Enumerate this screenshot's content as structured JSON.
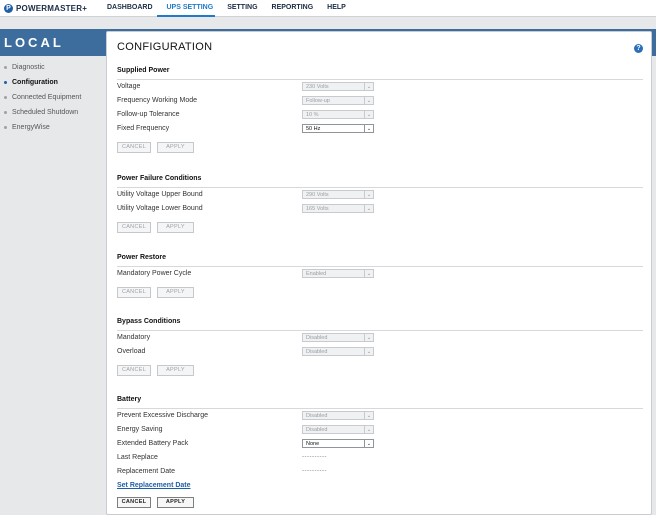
{
  "brand": {
    "name": "POWERMASTER+",
    "mark": "P"
  },
  "nav": {
    "items": [
      {
        "label": "DASHBOARD"
      },
      {
        "label": "UPS SETTING"
      },
      {
        "label": "SETTING"
      },
      {
        "label": "REPORTING"
      },
      {
        "label": "HELP"
      }
    ],
    "active": "UPS SETTING"
  },
  "sidebar": {
    "header": "LOCAL",
    "items": [
      {
        "label": "Diagnostic"
      },
      {
        "label": "Configuration"
      },
      {
        "label": "Connected Equipment"
      },
      {
        "label": "Scheduled Shutdown"
      },
      {
        "label": "EnergyWise"
      }
    ],
    "active": "Configuration"
  },
  "page": {
    "title": "CONFIGURATION",
    "help": "?"
  },
  "buttons": {
    "cancel": "CANCEL",
    "apply": "APPLY"
  },
  "sections": {
    "supplied_power": {
      "title": "Supplied Power",
      "rows": [
        {
          "label": "Voltage",
          "value": "230 Volts"
        },
        {
          "label": "Frequency Working Mode",
          "value": "Follow-up"
        },
        {
          "label": "Follow-up Tolerance",
          "value": "10 %"
        },
        {
          "label": "Fixed Frequency",
          "value": "50 Hz"
        }
      ]
    },
    "power_failure": {
      "title": "Power Failure Conditions",
      "rows": [
        {
          "label": "Utility Voltage Upper Bound",
          "value": "290 Volts"
        },
        {
          "label": "Utility Voltage Lower Bound",
          "value": "165 Volts"
        }
      ]
    },
    "power_restore": {
      "title": "Power Restore",
      "rows": [
        {
          "label": "Mandatory Power Cycle",
          "value": "Enabled"
        }
      ]
    },
    "bypass": {
      "title": "Bypass Conditions",
      "rows": [
        {
          "label": "Mandatory",
          "value": "Disabled"
        },
        {
          "label": "Overload",
          "value": "Disabled"
        }
      ]
    },
    "battery": {
      "title": "Battery",
      "rows": [
        {
          "label": "Prevent Excessive Discharge",
          "value": "Disabled"
        },
        {
          "label": "Energy Saving",
          "value": "Disabled"
        },
        {
          "label": "Extended Battery Pack",
          "value": "None"
        },
        {
          "label": "Last Replace",
          "value": "----------"
        },
        {
          "label": "Replacement Date",
          "value": "----------"
        }
      ],
      "link": "Set Replacement Date"
    }
  },
  "colors": {
    "accent": "#1f7ac8",
    "banner": "#3d6d9c",
    "brand": "#1f5fa8"
  }
}
